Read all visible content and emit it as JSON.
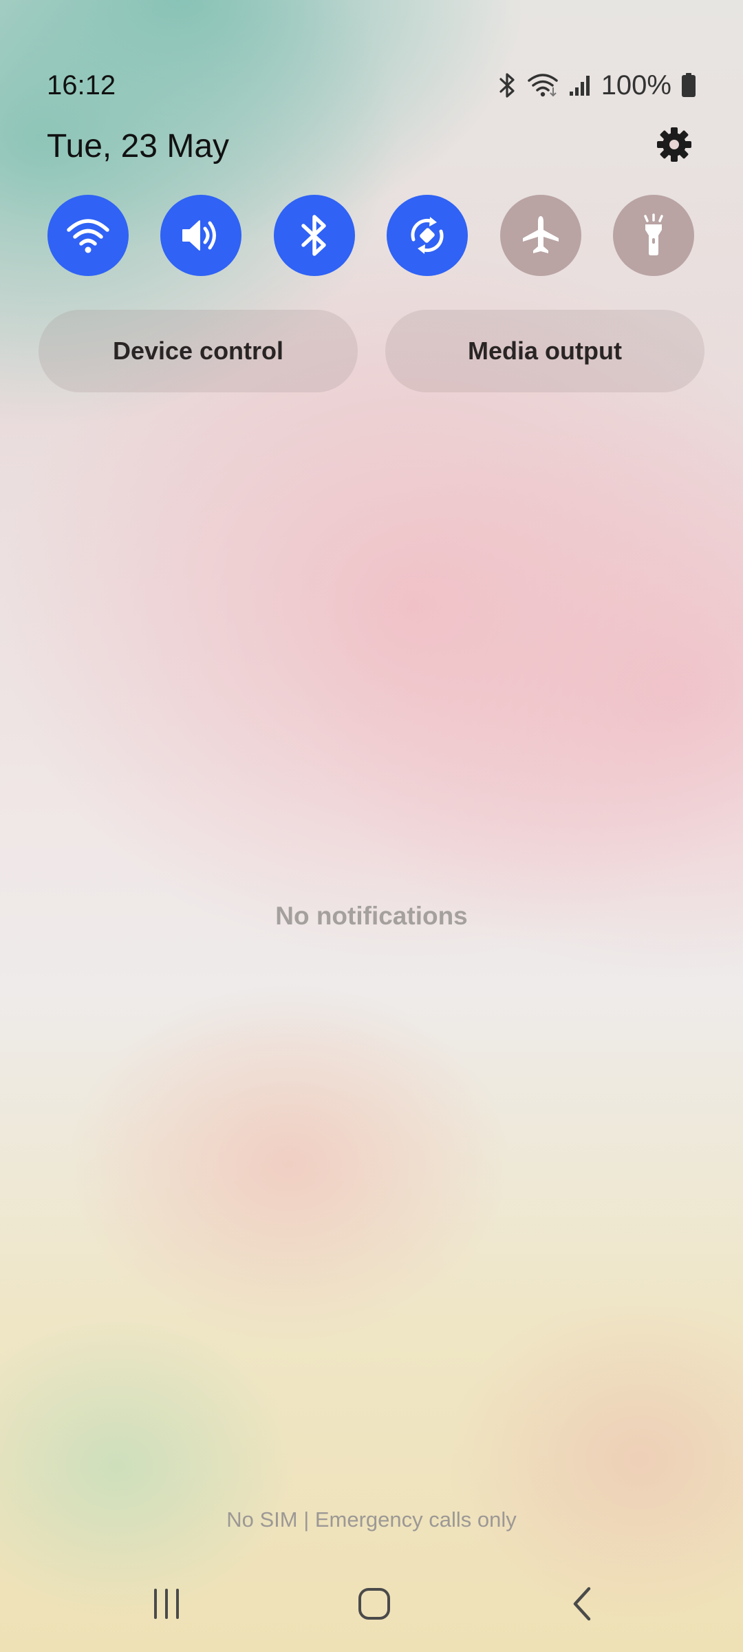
{
  "status_bar": {
    "time": "16:12",
    "battery_percent": "100%",
    "icons": [
      "bluetooth-icon",
      "wifi-icon",
      "signal-icon",
      "battery-icon"
    ]
  },
  "header": {
    "date": "Tue, 23 May",
    "settings_icon": "gear-icon"
  },
  "quick_toggles": [
    {
      "name": "wifi",
      "icon": "wifi-icon",
      "state": "on"
    },
    {
      "name": "sound",
      "icon": "speaker-icon",
      "state": "on"
    },
    {
      "name": "bluetooth",
      "icon": "bluetooth-icon",
      "state": "on"
    },
    {
      "name": "auto-rotate",
      "icon": "rotate-icon",
      "state": "on"
    },
    {
      "name": "airplane-mode",
      "icon": "airplane-icon",
      "state": "off"
    },
    {
      "name": "flashlight",
      "icon": "flashlight-icon",
      "state": "off"
    }
  ],
  "buttons": {
    "device_control": "Device control",
    "media_output": "Media output"
  },
  "notifications": {
    "empty_text": "No notifications"
  },
  "carrier": {
    "text": "No SIM | Emergency calls only"
  },
  "nav_bar": {
    "icons": [
      "recent-apps-icon",
      "home-icon",
      "back-icon"
    ]
  },
  "colors": {
    "toggle_on": "#2f62f5",
    "toggle_off": "#b9a3a3"
  }
}
